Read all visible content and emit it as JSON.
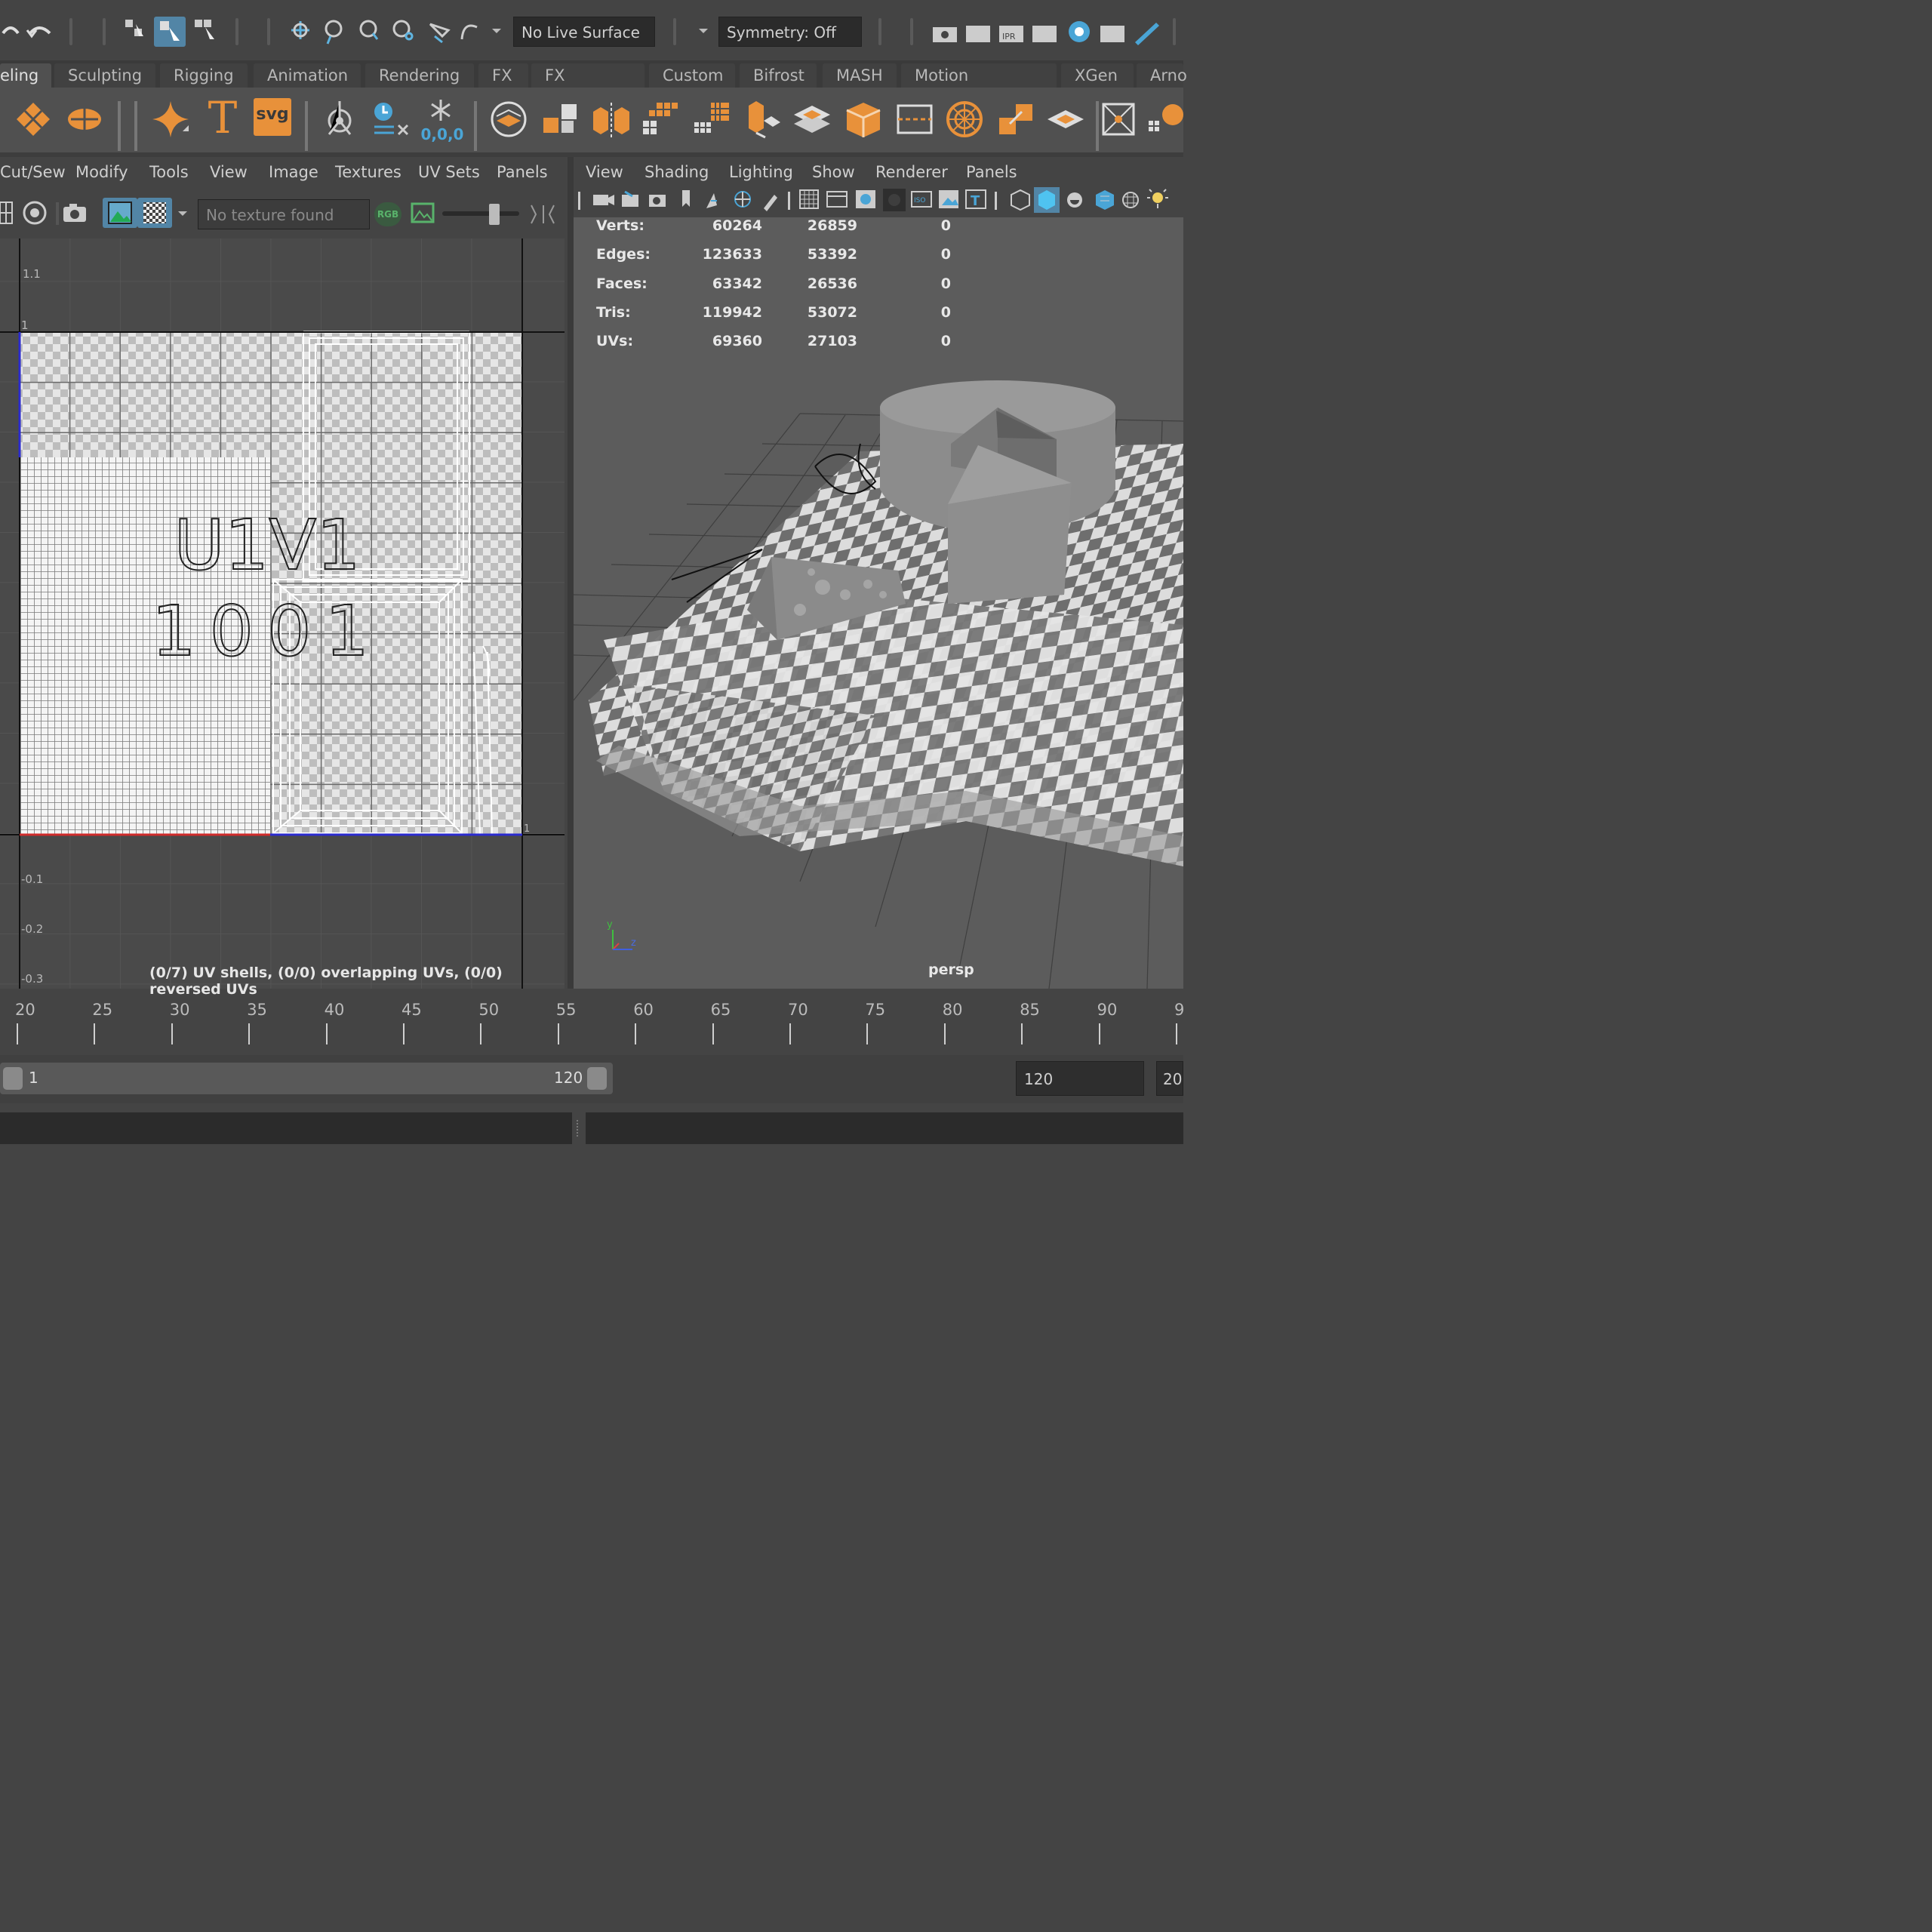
{
  "toolbar": {
    "live_surface": "No Live Surface",
    "symmetry": "Symmetry: Off"
  },
  "shelf_tabs": [
    {
      "label": "eling",
      "active": true
    },
    {
      "label": "Sculpting"
    },
    {
      "label": "Rigging"
    },
    {
      "label": "Animation"
    },
    {
      "label": "Rendering"
    },
    {
      "label": "FX"
    },
    {
      "label": "FX Caching"
    },
    {
      "label": "Custom"
    },
    {
      "label": "Bifrost"
    },
    {
      "label": "MASH"
    },
    {
      "label": "Motion Graphics"
    },
    {
      "label": "XGen"
    },
    {
      "label": "Arno"
    }
  ],
  "shelf": {
    "svg_label": "svg",
    "text_tool_label": "T",
    "origin_label": "0,0,0"
  },
  "uv_editor": {
    "menu": [
      "Cut/Sew",
      "Modify",
      "Tools",
      "View",
      "Image",
      "Textures",
      "UV Sets",
      "Panels"
    ],
    "texture_field": "No texture found",
    "rgb_label": "RGB",
    "tile_label_line1": "U1V1",
    "tile_label_line2": "1001",
    "axis_labels": [
      "1.1",
      "1",
      "-0.1",
      "-0.2",
      "-0.3"
    ],
    "right_edge_label": "1",
    "status": "(0/7) UV shells, (0/0) overlapping UVs, (0/0) reversed UVs"
  },
  "viewport": {
    "menu": [
      "View",
      "Shading",
      "Lighting",
      "Show",
      "Renderer",
      "Panels"
    ],
    "hud": [
      {
        "label": "Verts:",
        "c1": "60264",
        "c2": "26859",
        "c3": "0"
      },
      {
        "label": "Edges:",
        "c1": "123633",
        "c2": "53392",
        "c3": "0"
      },
      {
        "label": "Faces:",
        "c1": "63342",
        "c2": "26536",
        "c3": "0"
      },
      {
        "label": "Tris:",
        "c1": "119942",
        "c2": "53072",
        "c3": "0"
      },
      {
        "label": "UVs:",
        "c1": "69360",
        "c2": "27103",
        "c3": "0"
      }
    ],
    "camera_label": "persp",
    "axis_y": "y",
    "axis_z": "z"
  },
  "timeline": {
    "ticks": [
      "20",
      "25",
      "30",
      "35",
      "40",
      "45",
      "50",
      "55",
      "60",
      "65",
      "70",
      "75",
      "80",
      "85",
      "90",
      "9"
    ]
  },
  "range": {
    "start": "1",
    "end": "120",
    "playback_end": "120",
    "anim_end": "20"
  },
  "colors": {
    "accent_orange": "#e8913a",
    "accent_blue": "#4aa5d6",
    "active_button": "#5285a6"
  }
}
